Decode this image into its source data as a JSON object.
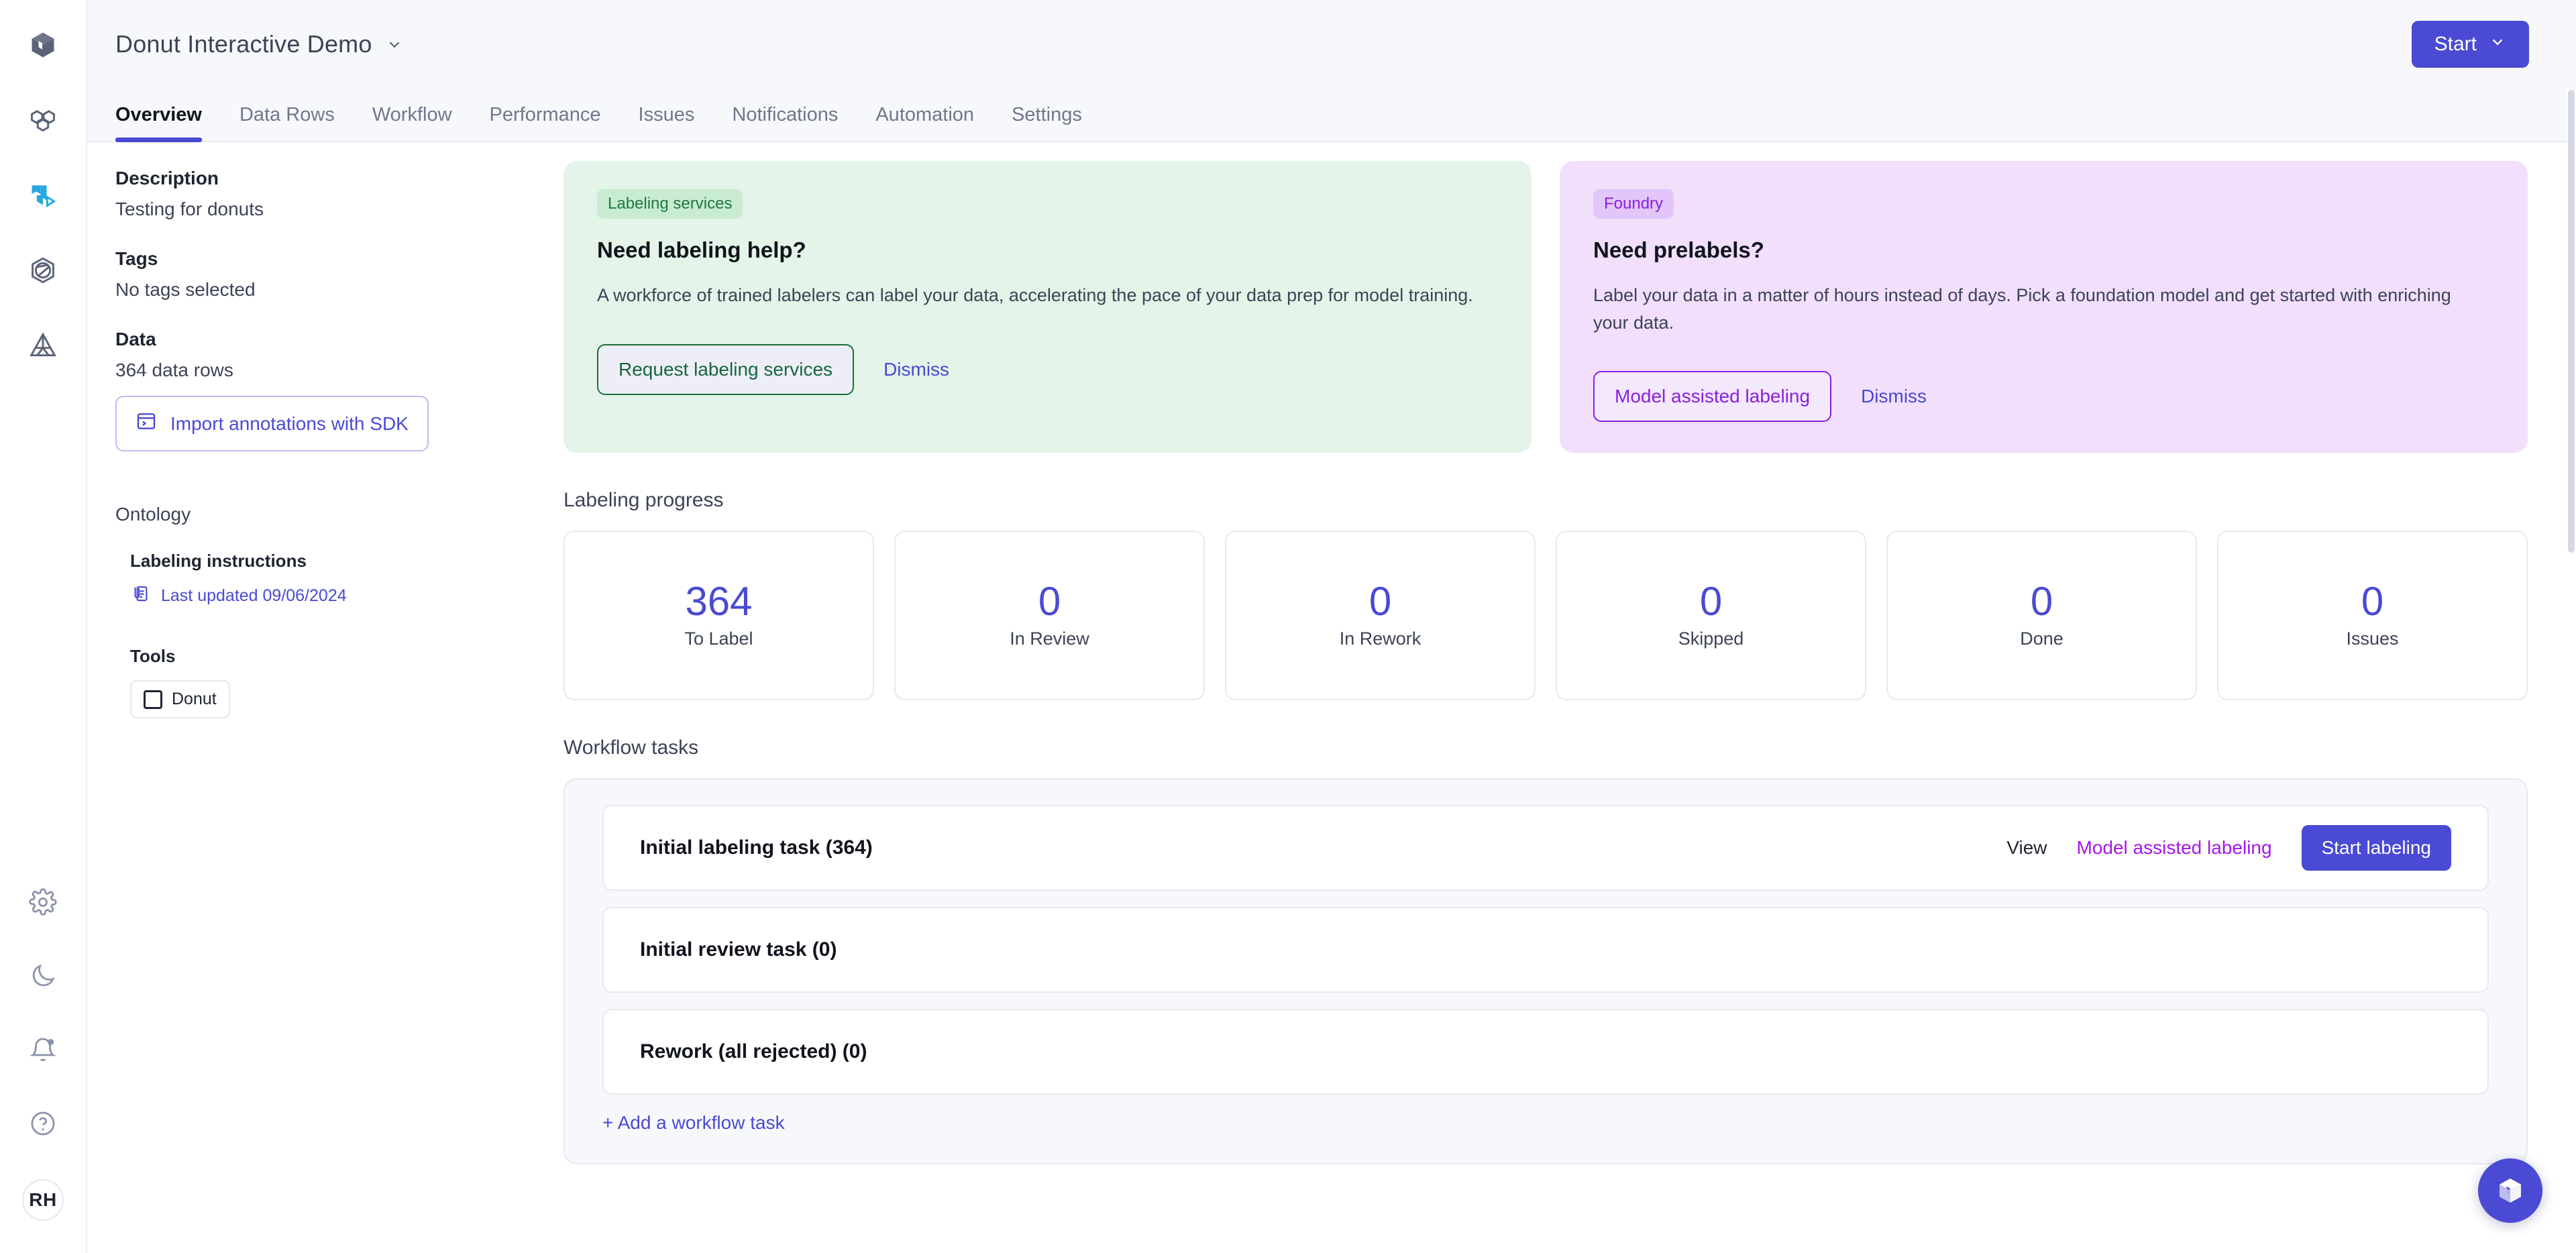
{
  "rail": {
    "top_icons": [
      {
        "name": "catalog-cube-icon",
        "title": "Catalog"
      },
      {
        "name": "model-shapes-icon",
        "title": "Models"
      },
      {
        "name": "annotate-flag-icon",
        "title": "Annotate"
      },
      {
        "name": "foundry-hexagon-icon",
        "title": "Foundry"
      },
      {
        "name": "analytics-triangle-icon",
        "title": "Analytics"
      }
    ],
    "bottom_icons": [
      {
        "name": "gear-icon",
        "title": "Settings"
      },
      {
        "name": "moon-icon",
        "title": "Dark mode"
      },
      {
        "name": "bell-icon",
        "title": "Notifications"
      },
      {
        "name": "help-circle-icon",
        "title": "Help"
      }
    ],
    "avatar_initials": "RH"
  },
  "header": {
    "project_title": "Donut Interactive Demo",
    "start_label": "Start"
  },
  "tabs": [
    {
      "label": "Overview",
      "active": true
    },
    {
      "label": "Data Rows",
      "active": false
    },
    {
      "label": "Workflow",
      "active": false
    },
    {
      "label": "Performance",
      "active": false
    },
    {
      "label": "Issues",
      "active": false
    },
    {
      "label": "Notifications",
      "active": false
    },
    {
      "label": "Automation",
      "active": false
    },
    {
      "label": "Settings",
      "active": false
    }
  ],
  "left_panel": {
    "description_label": "Description",
    "description_value": "Testing for donuts",
    "tags_label": "Tags",
    "tags_value": "No tags selected",
    "data_label": "Data",
    "data_value": "364 data rows",
    "import_sdk_label": "Import annotations with SDK",
    "ontology_label": "Ontology",
    "labeling_instructions_label": "Labeling instructions",
    "last_updated_label": "Last updated 09/06/2024",
    "tools_label": "Tools",
    "tool_items": [
      {
        "name": "Donut"
      }
    ]
  },
  "promos": [
    {
      "pill": "Labeling services",
      "title": "Need labeling help?",
      "body": "A workforce of trained labelers can label your data, accelerating the pace of your data prep for model training.",
      "primary": "Request labeling services",
      "secondary": "Dismiss",
      "accent": "#16683a"
    },
    {
      "pill": "Foundry",
      "title": "Need prelabels?",
      "body": "Label your data in a matter of hours instead of days. Pick a foundation model and get started with enriching your data.",
      "primary": "Model assisted labeling",
      "secondary": "Dismiss",
      "accent": "#8a1fe0"
    }
  ],
  "labeling_progress": {
    "title": "Labeling progress",
    "cards": [
      {
        "value": "364",
        "label": "To Label"
      },
      {
        "value": "0",
        "label": "In Review"
      },
      {
        "value": "0",
        "label": "In Rework"
      },
      {
        "value": "0",
        "label": "Skipped"
      },
      {
        "value": "0",
        "label": "Done"
      },
      {
        "value": "0",
        "label": "Issues"
      }
    ]
  },
  "workflow_tasks": {
    "title": "Workflow tasks",
    "rows": [
      {
        "name": "Initial labeling task  (364)",
        "view_label": "View",
        "mal_label": "Model assisted labeling",
        "start_label": "Start labeling",
        "has_actions": true
      },
      {
        "name": "Initial review task  (0)",
        "has_actions": false
      },
      {
        "name": "Rework (all rejected)  (0)",
        "has_actions": false
      }
    ],
    "add_task_label": "+ Add a workflow task"
  },
  "fab": {
    "name": "labelbox-cube-icon"
  },
  "colors": {
    "accent": "#4a4ad4",
    "magenta": "#a516e8",
    "green": "#16683a",
    "topbar_bg": "#f7f8fc"
  }
}
